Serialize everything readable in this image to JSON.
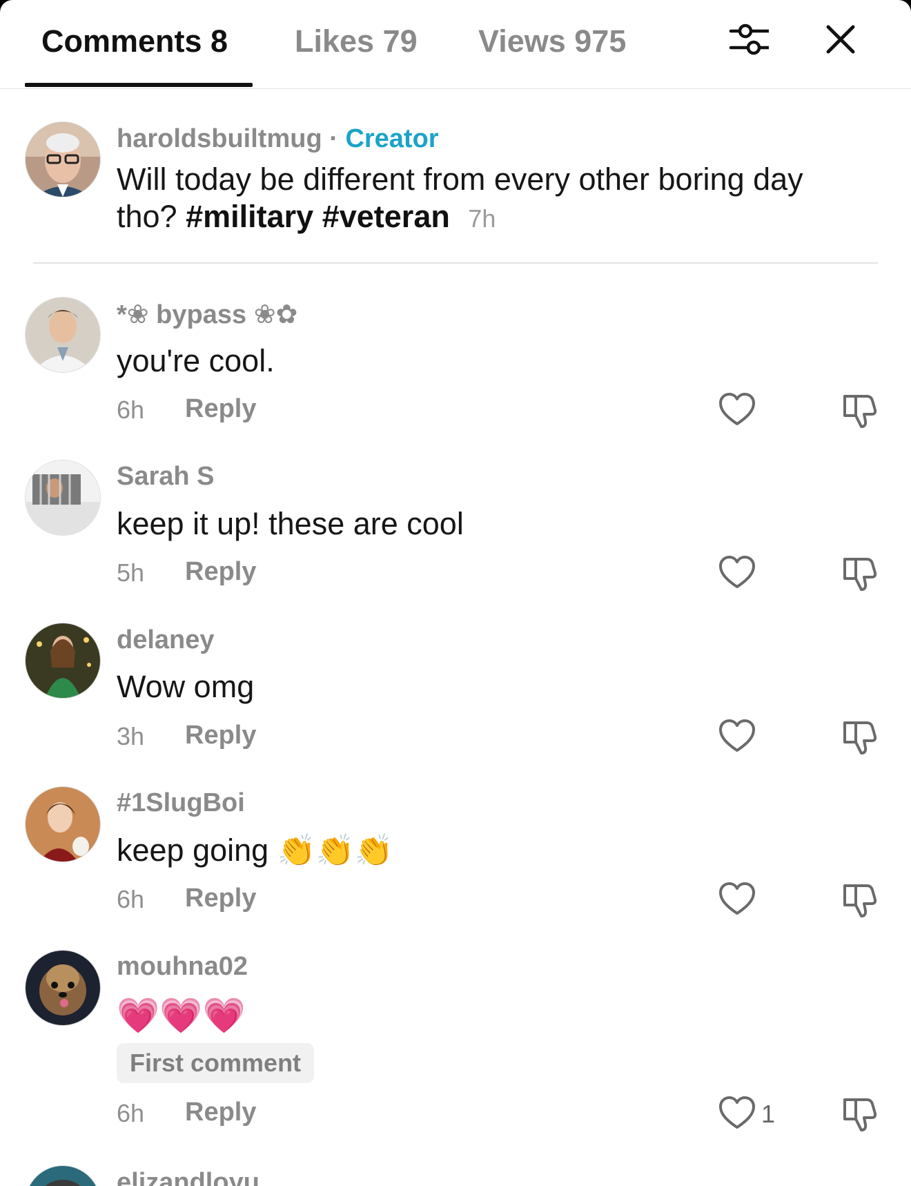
{
  "tabs": {
    "comments": "Comments 8",
    "likes": "Likes 79",
    "views": "Views 975"
  },
  "icons": {
    "filter": "sliders-icon",
    "close": "close-icon",
    "like": "heart-outline-icon",
    "dislike": "thumbs-down-outline-icon"
  },
  "colors": {
    "creator_accent": "#1aa3c9",
    "muted_text": "#8a8a8a",
    "primary_text": "#161616"
  },
  "post": {
    "username": "haroldsbuiltmug",
    "separator": "·",
    "role": "Creator",
    "line1": "Will today  be different from every other boring day",
    "line2_prefix": "tho? ",
    "hashtag1": "#military",
    "hashtag2": "#veteran",
    "time": "7h"
  },
  "comments": [
    {
      "username": "*❀ bypass ❀✿",
      "text": "you're cool.",
      "time": "6h",
      "reply": "Reply"
    },
    {
      "username": "Sarah S",
      "text": "keep it up! these are cool",
      "time": "5h",
      "reply": "Reply"
    },
    {
      "username": "delaney",
      "text": "Wow omg",
      "time": "3h",
      "reply": "Reply"
    },
    {
      "username": "#1SlugBoi",
      "text": "keep going",
      "emoji": "👏👏👏",
      "time": "6h",
      "reply": "Reply"
    },
    {
      "username": "mouhna02",
      "emoji": "💗💗💗",
      "badge": "First comment",
      "time": "6h",
      "reply": "Reply",
      "likes": "1"
    },
    {
      "username": "elizandloyu"
    }
  ]
}
